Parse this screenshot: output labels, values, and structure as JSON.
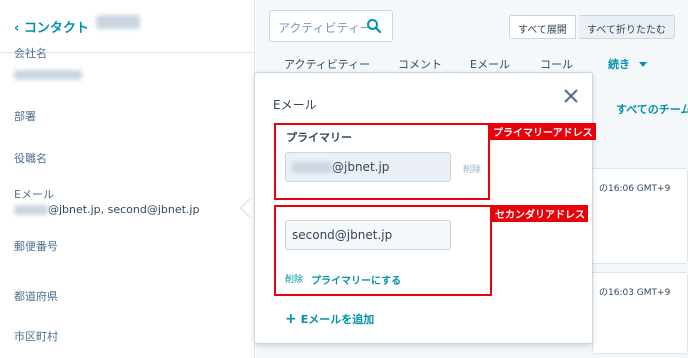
{
  "left": {
    "back_label": "‹ コンタクト",
    "fields": [
      {
        "label": "会社名",
        "value_visible": false
      },
      {
        "label": "部署"
      },
      {
        "label": "役職名"
      },
      {
        "label": "Eメール",
        "value_suffix": "@jbnet.jp, second@jbnet.jp"
      },
      {
        "label": "郵便番号"
      },
      {
        "label": "都道府県"
      },
      {
        "label": "市区町村"
      }
    ]
  },
  "right": {
    "search_placeholder": "アクティビティー",
    "expand_all": "すべて展開",
    "collapse_all": "すべて折りたたむ",
    "tabs": [
      "アクティビティー",
      "コメント",
      "Eメール",
      "コール",
      "続き"
    ],
    "teams_label": "すべてのチーム",
    "card1_time": "の16:06 GMT+9",
    "card2_time": "の16:03 GMT+9"
  },
  "popover": {
    "title": "Eメール",
    "primary_label": "プライマリー",
    "primary_email_suffix": "@jbnet.jp",
    "delete_label": "削除",
    "second_email": "second@jbnet.jp",
    "delete_label_short": "削除",
    "make_primary": "プライマリーにする",
    "add_email": "Eメールを追加"
  },
  "annotations": {
    "primary": "プライマリーアドレス",
    "secondary": "セカンダリアドレス",
    "color": "#e8000a"
  },
  "colors": {
    "accent": "#0091ae",
    "text": "#33475b",
    "border": "#cbd6e2"
  }
}
